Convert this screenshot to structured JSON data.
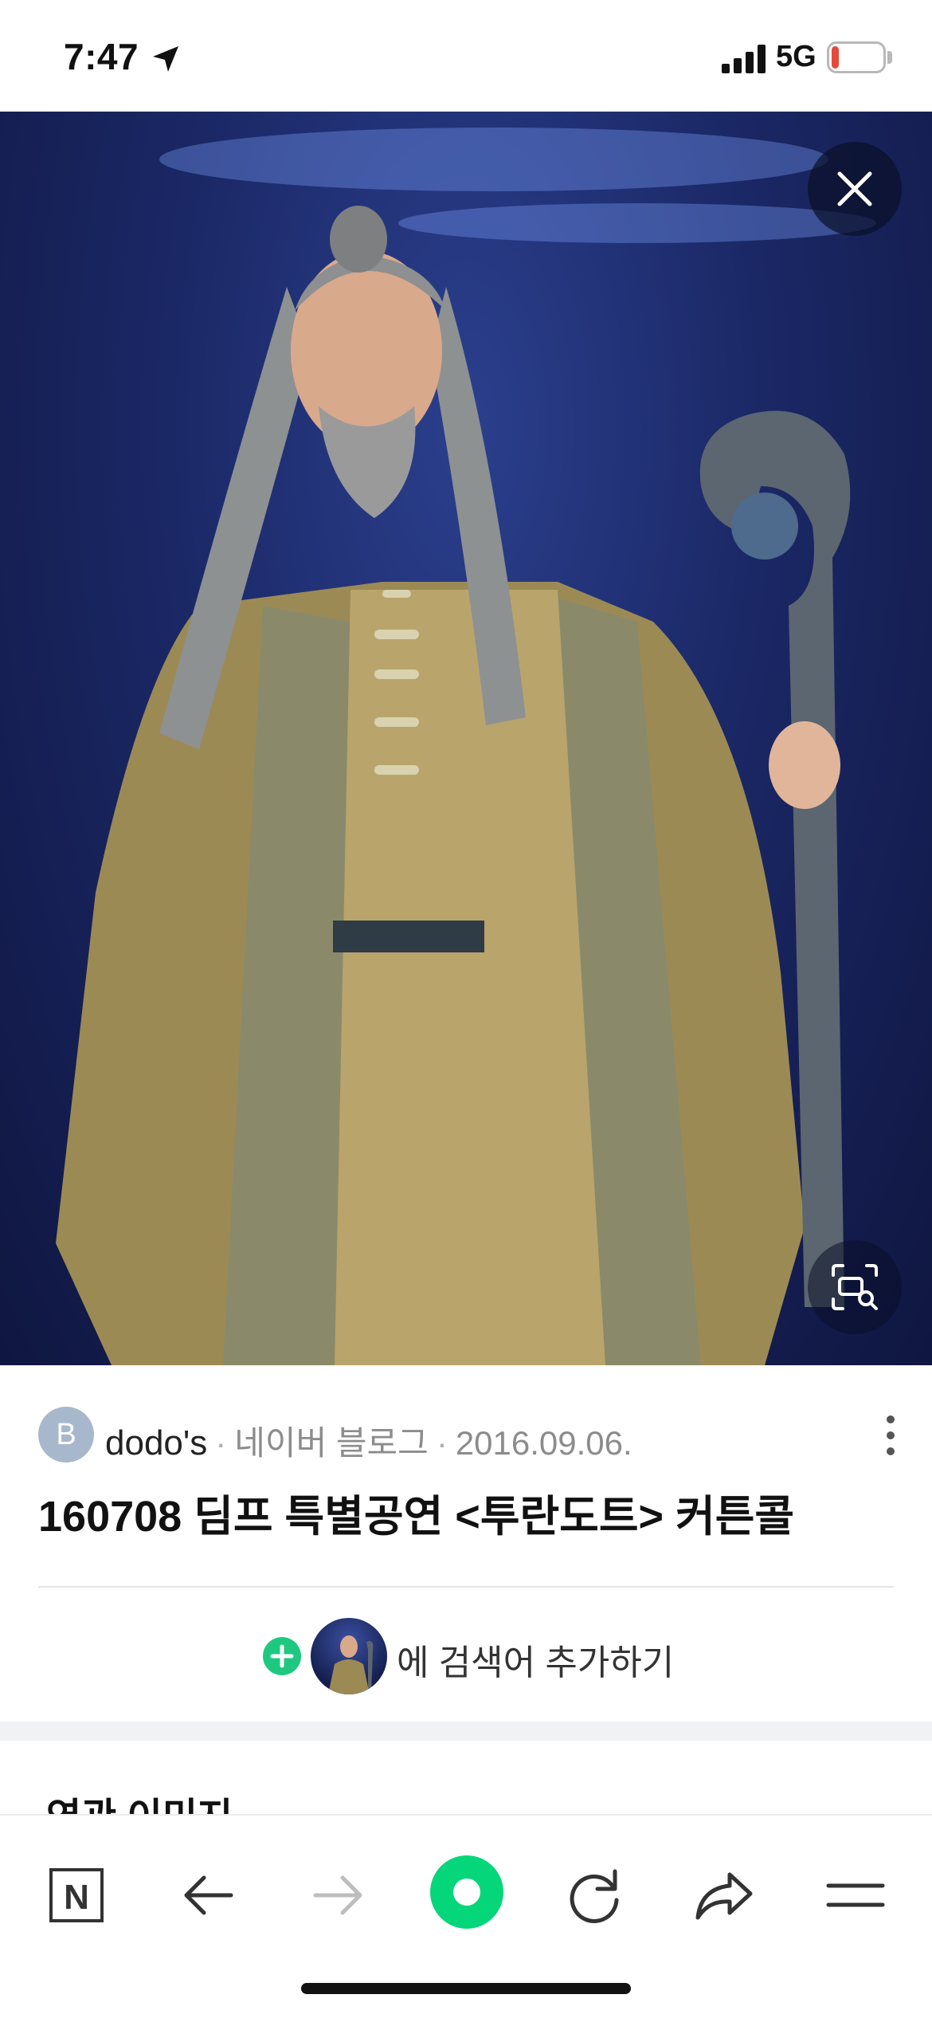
{
  "status_bar": {
    "time": "7:47",
    "network": "5G",
    "battery": "15",
    "battery_level": 0.15
  },
  "viewer": {
    "close_icon": "close-icon",
    "lens_icon": "image-search-icon"
  },
  "source": {
    "avatar_letter": "B",
    "name": "dodo's",
    "separator": "·",
    "platform": "네이버 블로그",
    "date": "2016.09.06."
  },
  "title": "160708 딤프 특별공연 <투란도트> 커튼콜",
  "add_search": {
    "text": "에 검색어 추가하기"
  },
  "related": {
    "title": "연관 이미지"
  },
  "toolbar": {
    "items": [
      "naver-home-icon",
      "back-arrow-icon",
      "forward-arrow-icon",
      "green-dot-icon",
      "refresh-icon",
      "share-icon",
      "menu-icon"
    ],
    "naver_letter": "N"
  },
  "colors": {
    "accent_green": "#05d67a",
    "plus_green": "#1ec97f",
    "battery_red": "#e5483c"
  }
}
